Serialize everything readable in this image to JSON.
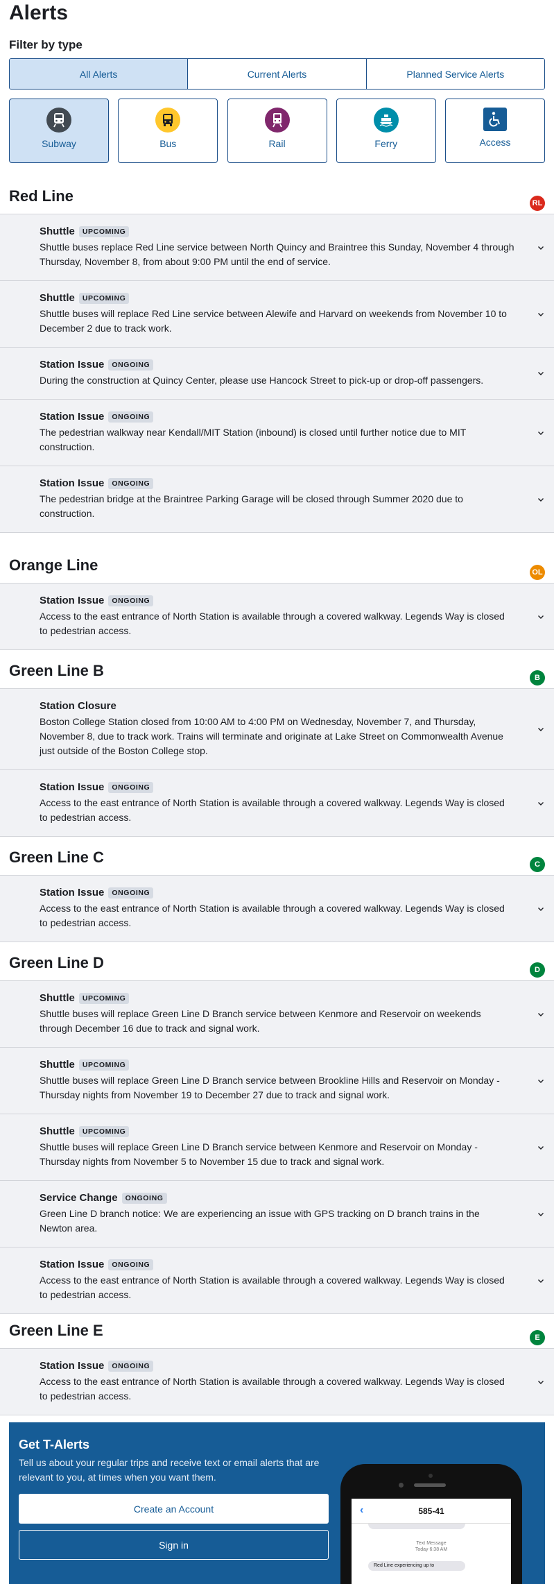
{
  "page_title": "Alerts",
  "filter_heading": "Filter by type",
  "alert_type_tabs": [
    {
      "label": "All Alerts",
      "active": true
    },
    {
      "label": "Current Alerts",
      "active": false
    },
    {
      "label": "Planned Service Alerts",
      "active": false
    }
  ],
  "modes": [
    {
      "label": "Subway",
      "icon": "subway-icon",
      "color": "#424a52",
      "active": true
    },
    {
      "label": "Bus",
      "icon": "bus-icon",
      "color": "#ffc72c",
      "active": false
    },
    {
      "label": "Rail",
      "icon": "commuter-rail-icon",
      "color": "#80276c",
      "active": false
    },
    {
      "label": "Ferry",
      "icon": "ferry-icon",
      "color": "#008eaa",
      "active": false
    },
    {
      "label": "Access",
      "icon": "accessibility-icon",
      "color": "#165c96",
      "active": false
    }
  ],
  "lines": [
    {
      "name": "Red Line",
      "badge": "RL",
      "color": "#da291c",
      "alerts": [
        {
          "type": "Shuttle",
          "status": "UPCOMING",
          "text": "Shuttle buses replace Red Line service between North Quincy and Braintree this Sunday, November 4 through Thursday, November 8, from about 9:00 PM until the end of service."
        },
        {
          "type": "Shuttle",
          "status": "UPCOMING",
          "text": "Shuttle buses will replace Red Line service between Alewife and Harvard on weekends from November 10 to December 2 due to track work."
        },
        {
          "type": "Station Issue",
          "status": "ONGOING",
          "text": "During the construction at Quincy Center, please use Hancock Street to pick-up or drop-off passengers."
        },
        {
          "type": "Station Issue",
          "status": "ONGOING",
          "text": "The pedestrian walkway near Kendall/MIT Station (inbound) is closed until further notice due to MIT construction."
        },
        {
          "type": "Station Issue",
          "status": "ONGOING",
          "text": "The pedestrian bridge at the Braintree Parking Garage will be closed through Summer 2020 due to construction."
        }
      ]
    },
    {
      "name": "Orange Line",
      "badge": "OL",
      "color": "#ed8b00",
      "alerts": [
        {
          "type": "Station Issue",
          "status": "ONGOING",
          "text": "Access to the east entrance of North Station is available through a covered walkway. Legends Way is closed to pedestrian access."
        }
      ]
    },
    {
      "name": "Green Line B",
      "badge": "B",
      "color": "#00843d",
      "alerts": [
        {
          "type": "Station Closure",
          "status": "",
          "text": "Boston College Station closed from 10:00 AM to 4:00 PM on Wednesday, November 7, and Thursday, November 8, due to track work. Trains will terminate and originate at Lake Street on Commonwealth Avenue just outside of the Boston College stop."
        },
        {
          "type": "Station Issue",
          "status": "ONGOING",
          "text": "Access to the east entrance of North Station is available through a covered walkway. Legends Way is closed to pedestrian access."
        }
      ]
    },
    {
      "name": "Green Line C",
      "badge": "C",
      "color": "#00843d",
      "alerts": [
        {
          "type": "Station Issue",
          "status": "ONGOING",
          "text": "Access to the east entrance of North Station is available through a covered walkway. Legends Way is closed to pedestrian access."
        }
      ]
    },
    {
      "name": "Green Line D",
      "badge": "D",
      "color": "#00843d",
      "alerts": [
        {
          "type": "Shuttle",
          "status": "UPCOMING",
          "text": "Shuttle buses will replace Green Line D Branch service between Kenmore and Reservoir on weekends through December 16 due to track and signal work."
        },
        {
          "type": "Shuttle",
          "status": "UPCOMING",
          "text": "Shuttle buses will replace Green Line D Branch service between Brookline Hills and Reservoir on Monday - Thursday nights from November 19 to December 27 due to track and signal work."
        },
        {
          "type": "Shuttle",
          "status": "UPCOMING",
          "text": "Shuttle buses will replace Green Line D Branch service between Kenmore and Reservoir on Monday - Thursday nights from November 5 to November 15 due to track and signal work."
        },
        {
          "type": "Service Change",
          "status": "ONGOING",
          "text": "Green Line D branch notice: We are experiencing an issue with GPS tracking on D branch trains in the Newton area."
        },
        {
          "type": "Station Issue",
          "status": "ONGOING",
          "text": "Access to the east entrance of North Station is available through a covered walkway. Legends Way is closed to pedestrian access."
        }
      ]
    },
    {
      "name": "Green Line E",
      "badge": "E",
      "color": "#00843d",
      "alerts": [
        {
          "type": "Station Issue",
          "status": "ONGOING",
          "text": "Access to the east entrance of North Station is available through a covered walkway. Legends Way is closed to pedestrian access."
        }
      ]
    }
  ],
  "t_alerts": {
    "title": "Get T-Alerts",
    "description": "Tell us about your regular trips and receive text or email alerts that are relevant to you, at times when you want them.",
    "create_account_label": "Create an Account",
    "sign_in_label": "Sign in",
    "phone": {
      "number": "585-41",
      "message_tag": "Text Message",
      "message_time": "Today 6:38 AM",
      "bubble_text": "Red Line experiencing up to"
    }
  }
}
